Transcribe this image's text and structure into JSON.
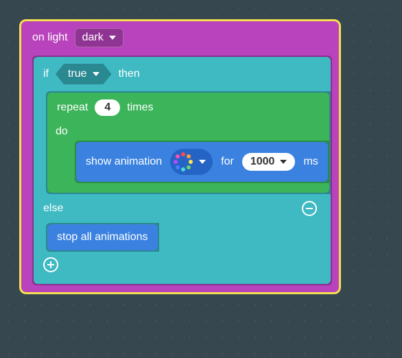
{
  "event": {
    "prefix": "on light",
    "condition": "dark"
  },
  "if_block": {
    "if_label": "if",
    "bool_value": "true",
    "then_label": "then",
    "else_label": "else"
  },
  "repeat": {
    "prefix": "repeat",
    "count": "4",
    "suffix": "times",
    "do_label": "do"
  },
  "show_animation": {
    "prefix": "show animation",
    "animation": "rainbow",
    "for_label": "for",
    "duration": "1000",
    "unit": "ms"
  },
  "stop_animations": {
    "label": "stop all animations"
  },
  "colors": {
    "ring": [
      "#ff4d4d",
      "#ff9f40",
      "#ffe74c",
      "#6bd36b",
      "#45d9d9",
      "#4d7dff",
      "#b34dff",
      "#ff4db8"
    ]
  }
}
